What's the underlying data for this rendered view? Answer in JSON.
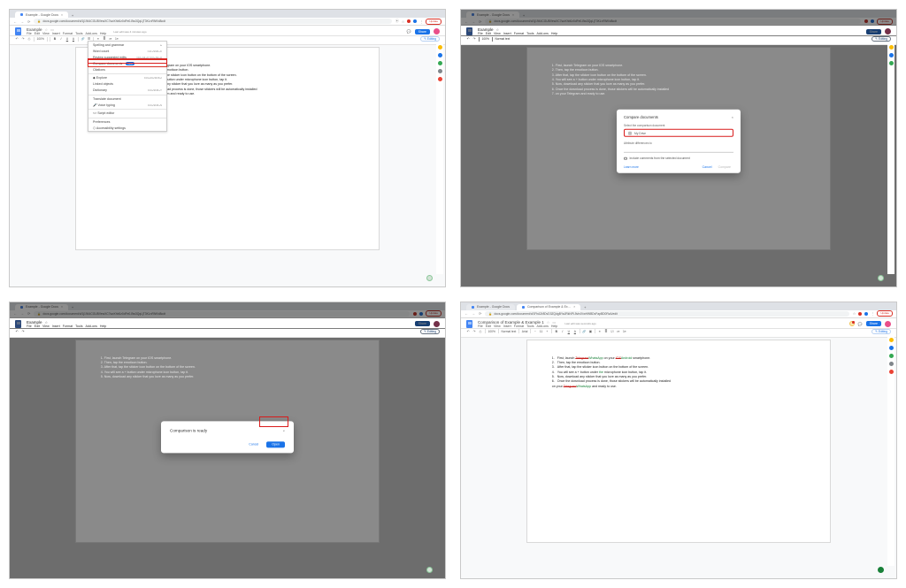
{
  "common": {
    "tab_close": "×",
    "newtab": "+",
    "nav_back": "←",
    "nav_fwd": "→",
    "nav_reload": "⟳",
    "lock": "🔒",
    "url_translate": "⦿",
    "url_star": "☆",
    "ext_red": "#d93025",
    "ext_blue": "#1a73e8",
    "chrome_menu": "⋮",
    "update_label": "Update",
    "share": "Share",
    "editing": "Editing",
    "comment_ic": "💬",
    "meet_ic": "▦",
    "star": "☆",
    "move": "▭",
    "menus": [
      "File",
      "Edit",
      "View",
      "Insert",
      "Format",
      "Tools",
      "Add-ons",
      "Help"
    ],
    "toolbar_font": "Arial",
    "toolbar_size": "11",
    "toolbar_zoom": "100%",
    "toolbar_style": "Normal text"
  },
  "p1": {
    "tab_title": "Example - Google Docs",
    "url": "docs.google.com/document/d/1j1944CGUBVewXC7swXhb0z0dFe0-Bw3QqLjT3KLnRfW/d8odt",
    "doc_title": "Example",
    "last_edit": "Last edit was 4 minutes ago",
    "doc_lines": [
      ", launch Telegram on your IOS smartphone.",
      "en, tap the emoticon button.",
      "er that, tap the sticker icon button on the bottom of the screen.",
      " will see a + button under microphone icon button, tap it.",
      ", download any sticker that you love as many as you prefer.",
      "e the download process is done, those stickers will be automatically installed",
      "your Telegram and ready to use."
    ],
    "tools_menu": [
      {
        "label": "Spelling and grammar",
        "rt": "▸"
      },
      {
        "label": "Word count",
        "rt": "Ctrl+Shift+C"
      },
      {
        "label": "Review suggested edits",
        "rt": "Ctrl+Alt+O Ctrl+Alt+U"
      },
      {
        "label": "Compare documents",
        "rt": "",
        "badge": "New",
        "hi": true
      },
      {
        "label": "Citations",
        "rt": ""
      },
      {
        "label": "Explore",
        "rt": "Ctrl+Alt+Shift+I",
        "sep": true,
        "ic": "◆"
      },
      {
        "label": "Linked objects",
        "rt": ""
      },
      {
        "label": "Dictionary",
        "rt": "Ctrl+Shift+Y"
      },
      {
        "label": "Translate document",
        "rt": "",
        "sep": true
      },
      {
        "label": "Voice typing",
        "rt": "Ctrl+Shift+S",
        "ic": "🎤"
      },
      {
        "label": "Script editor",
        "rt": "",
        "sep": true,
        "ic": "<>"
      },
      {
        "label": "Preferences",
        "rt": "",
        "sep": true
      },
      {
        "label": "Accessibility settings",
        "rt": "",
        "ic": "⬡"
      }
    ]
  },
  "p2": {
    "tab_title": "Example - Google Docs",
    "url": "docs.google.com/document/d/1j1944CGUBVewXC7swXhb0z0dFe0-Bw3QqLjT3KLnRfW/d8odt",
    "doc_title": "Example",
    "last_edit": "Last edit was seconds ago",
    "doc_lines": [
      "First, launch Telegram on your IOS smartphone.",
      "Then, tap the emoticon button.",
      "After that, tap the sticker icon button on the bottom of the screen.",
      "You will see a + button under microphone icon button, tap it.",
      "Now, download any sticker that you love as many as you prefer.",
      "Once the download process is done, those stickers will be automatically installed",
      "on your Telegram and ready to use."
    ],
    "dialog": {
      "title": "Compare documents",
      "select_label": "Select the comparison document",
      "chip_text": "My Drive",
      "attr_label": "Attribute differences to",
      "include_label": "Include comments from the selected document",
      "learn": "Learn more",
      "cancel": "Cancel",
      "compare": "Compare"
    }
  },
  "p3": {
    "tab_title": "Example - Google Docs",
    "url": "docs.google.com/document/d/1j1944CGUBVewXC7swXhb0z0dFe0-Bw3QqLjT3KLnRfW/d8odt",
    "doc_title": "Example",
    "last_edit": "Last edit was seconds ago",
    "doc_lines": [
      "First, launch Telegram on your IOS smartphone.",
      "Then, tap the emoticon button.",
      "After that, tap the sticker icon button on the bottom of the screen.",
      "You will see a + button under microphone icon button, tap it.",
      "Now, download any sticker that you love as many as you prefer."
    ],
    "dialog": {
      "title": "Comparison is ready",
      "cancel": "Cancel",
      "open": "Open"
    }
  },
  "p4": {
    "tabs": [
      "Example - Google Docs",
      "Comparison of Example & Ex…"
    ],
    "url": "docs.google.com/document/d/1FhAZr8DvD3ZQdgBYaJRkNPL5vh4VwHWBDvFapBD0RzA/edit",
    "doc_title": "Comparison of Example & Example 1",
    "last_edit": "Last edit was seconds ago",
    "doc_lines_rich": [
      [
        {
          "t": "1.",
          "c": "num"
        },
        {
          "t": "First, launch "
        },
        {
          "t": "Telegram",
          "c": "diff-del"
        },
        {
          "t": "WhatsApp",
          "c": "diff-ins"
        },
        {
          "t": " on your "
        },
        {
          "t": "IOS",
          "c": "diff-del"
        },
        {
          "t": "Android",
          "c": "diff-ins"
        },
        {
          "t": " smartphone."
        }
      ],
      [
        {
          "t": "2.",
          "c": "num"
        },
        {
          "t": "Then, tap the emoticon button."
        }
      ],
      [
        {
          "t": "3.",
          "c": "num"
        },
        {
          "t": "After that, tap the sticker icon button on the bottom of the screen."
        }
      ],
      [
        {
          "t": "4.",
          "c": "num"
        },
        {
          "t": "You will see a + button under "
        },
        {
          "t": "the ",
          "c": "diff-ins"
        },
        {
          "t": "microphone icon button, tap it."
        }
      ],
      [
        {
          "t": "5.",
          "c": "num"
        },
        {
          "t": "Now, download any sticker that you love as many as you prefer."
        }
      ],
      [
        {
          "t": "6.",
          "c": "num"
        },
        {
          "t": "Once the download process is done, those stickers will be automatically installed"
        }
      ],
      [
        {
          "t": "   "
        },
        {
          "t": "on your "
        },
        {
          "t": "Telegram",
          "c": "diff-del"
        },
        {
          "t": "WhatsApp",
          "c": "diff-ins"
        },
        {
          "t": " and ready to use."
        }
      ]
    ]
  }
}
